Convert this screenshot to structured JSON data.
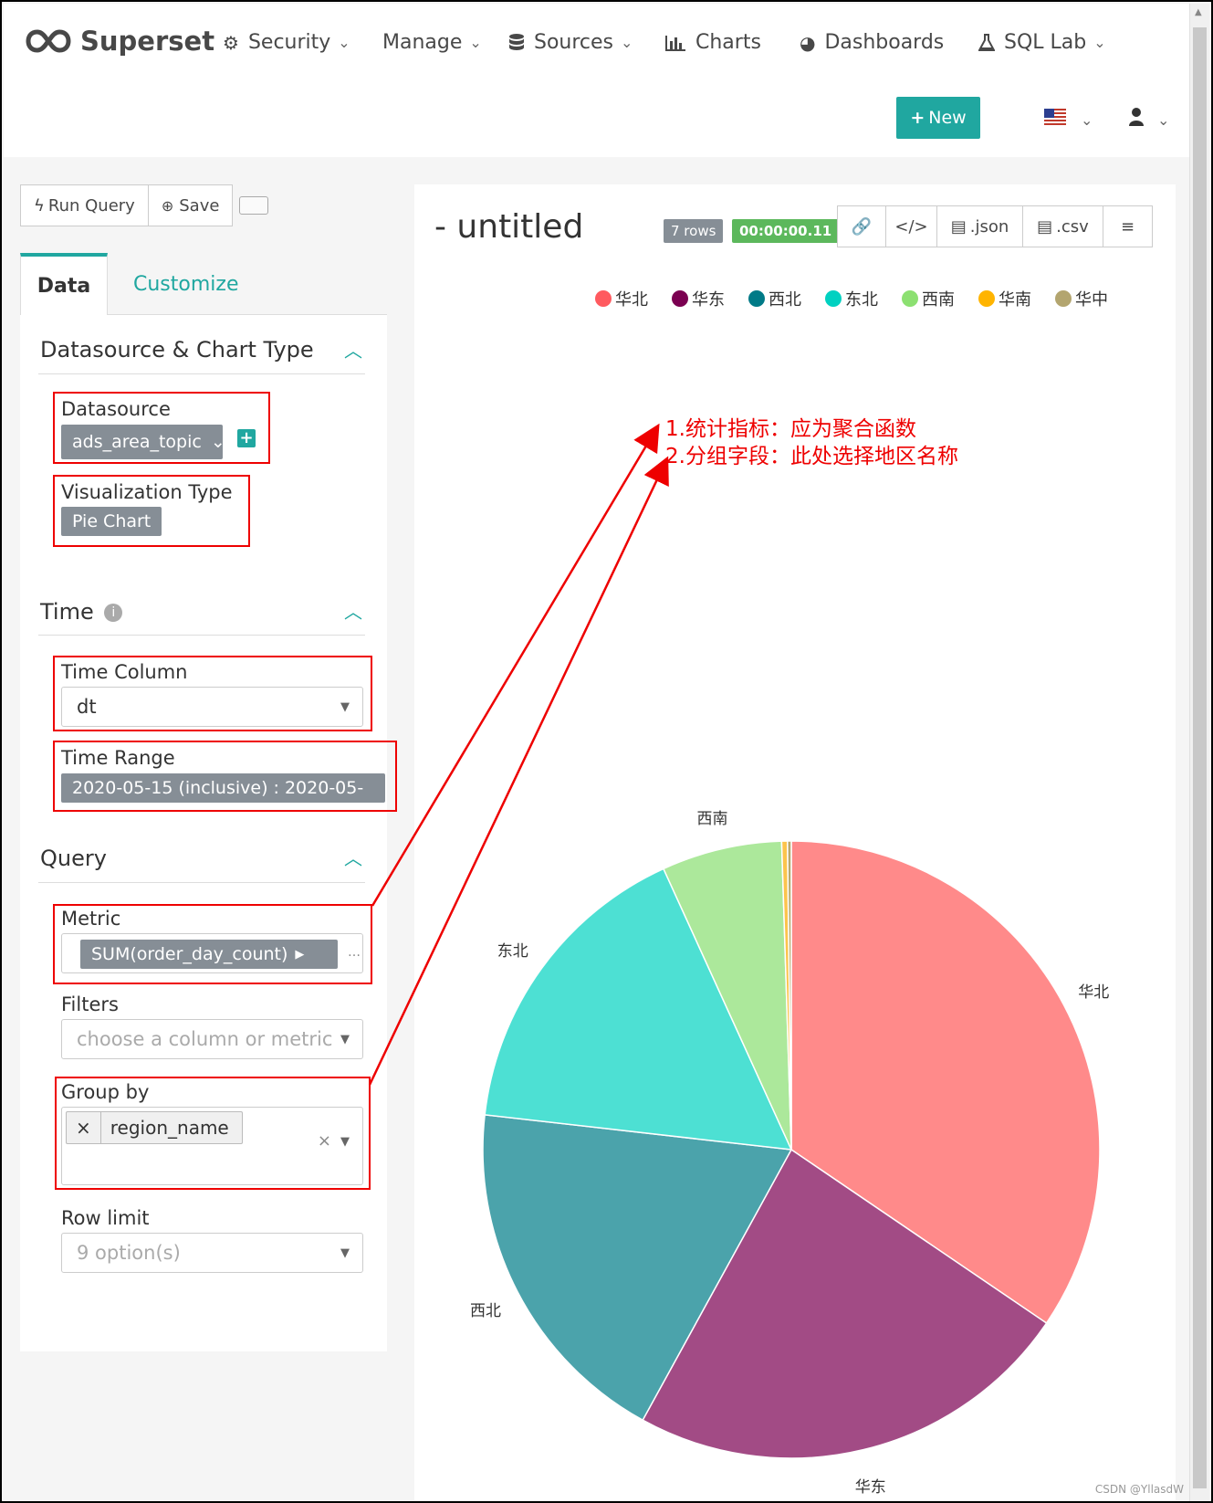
{
  "nav": {
    "brand": "Superset",
    "items": [
      {
        "label": "Security",
        "icon": "gears-icon"
      },
      {
        "label": "Manage",
        "icon": ""
      },
      {
        "label": "Sources",
        "icon": "database-icon"
      },
      {
        "label": "Charts",
        "icon": "bar-chart-icon"
      },
      {
        "label": "Dashboards",
        "icon": "dashboard-icon"
      },
      {
        "label": "SQL Lab",
        "icon": "flask-icon"
      }
    ],
    "new_label": "New"
  },
  "toolbar": {
    "run_query": "Run Query",
    "save": "Save"
  },
  "tabs": {
    "data": "Data",
    "customize": "Customize"
  },
  "sections": {
    "datasource": {
      "title": "Datasource & Chart Type",
      "datasource_label": "Datasource",
      "datasource_value": "ads_area_topic",
      "viz_label": "Visualization Type",
      "viz_value": "Pie Chart"
    },
    "time": {
      "title": "Time",
      "column_label": "Time Column",
      "column_value": "dt",
      "range_label": "Time Range",
      "range_value": "2020-05-15 (inclusive) : 2020-05-"
    },
    "query": {
      "title": "Query",
      "metric_label": "Metric",
      "metric_value": "SUM(order_day_count)",
      "filters_label": "Filters",
      "filters_placeholder": "choose a column or metric",
      "groupby_label": "Group by",
      "groupby_value": "region_name",
      "rowlimit_label": "Row limit",
      "rowlimit_placeholder": "9 option(s)"
    }
  },
  "chart": {
    "title": "- untitled",
    "rows_badge": "7 rows",
    "time_badge": "00:00:00.11",
    "json_label": ".json",
    "csv_label": ".csv"
  },
  "annotations": [
    "1.统计指标：应为聚合函数",
    "2.分组字段：此处选择地区名称"
  ],
  "watermark": "CSDN @YllasdW",
  "colors": {
    "accent": "#20a7a0",
    "annotation": "#e00000",
    "rows_badge": "#868e96",
    "time_badge": "#5cb85c"
  },
  "chart_data": {
    "type": "pie",
    "categories": [
      "华北",
      "华东",
      "西北",
      "东北",
      "西南",
      "华南",
      "华中"
    ],
    "values": [
      34.5,
      23.5,
      18.8,
      16.4,
      6.3,
      0.3,
      0.2
    ],
    "colors": [
      "#ff8a8a",
      "#a24b85",
      "#4ba3ab",
      "#4de0d3",
      "#ace89b",
      "#fcc44d",
      "#b8a970"
    ],
    "legend": [
      "华北",
      "华东",
      "西北",
      "东北",
      "西南",
      "华南",
      "华中"
    ],
    "legend_colors": [
      "#ff5a5f",
      "#7b0051",
      "#007a87",
      "#00d1c1",
      "#8ce071",
      "#ffb400",
      "#b3a56f"
    ],
    "slice_labels": [
      "华北",
      "华东",
      "西北",
      "东北",
      "西南"
    ]
  }
}
